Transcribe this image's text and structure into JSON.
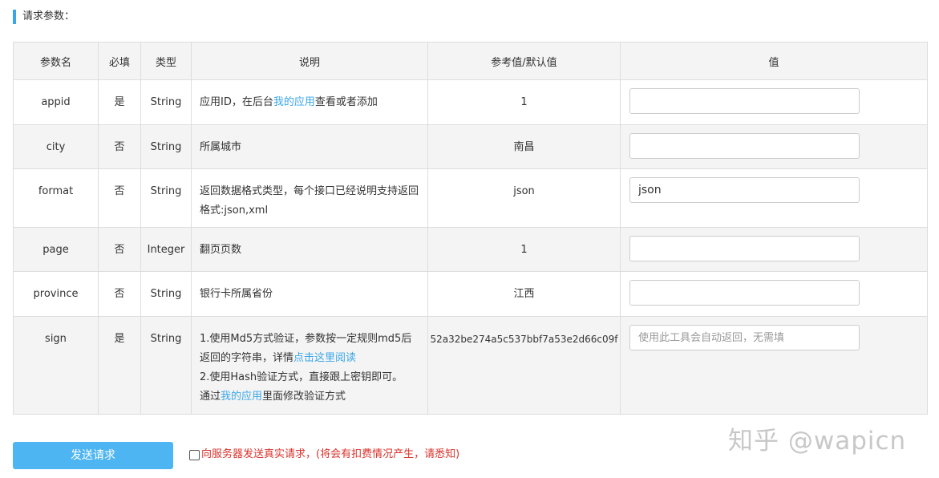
{
  "section_title": "请求参数：",
  "table": {
    "headers": [
      "参数名",
      "必填",
      "类型",
      "说明",
      "参考值/默认值",
      "值"
    ],
    "rows": [
      {
        "name": "appid",
        "required": "是",
        "type": "String",
        "desc_before": "应用ID，在后台",
        "desc_link": "我的应用",
        "desc_after": "查看或者添加",
        "ref": "1",
        "value": "",
        "placeholder": ""
      },
      {
        "name": "city",
        "required": "否",
        "type": "String",
        "desc": "所属城市",
        "ref": "南昌",
        "value": "",
        "placeholder": ""
      },
      {
        "name": "format",
        "required": "否",
        "type": "String",
        "desc": "返回数据格式类型，每个接口已经说明支持返回格式:json,xml",
        "ref": "json",
        "value": "json",
        "placeholder": ""
      },
      {
        "name": "page",
        "required": "否",
        "type": "Integer",
        "desc": "翻页页数",
        "ref": "1",
        "value": "",
        "placeholder": ""
      },
      {
        "name": "province",
        "required": "否",
        "type": "String",
        "desc": "银行卡所属省份",
        "ref": "江西",
        "value": "",
        "placeholder": ""
      },
      {
        "name": "sign",
        "required": "是",
        "type": "String",
        "desc_line1": "1.使用Md5方式验证，参数按一定规则md5后返回的字符串，详情",
        "desc_link1": "点击这里阅读",
        "desc_line2": "2.使用Hash验证方式，直接跟上密钥即可。",
        "desc_line3_before": "通过",
        "desc_link2": "我的应用",
        "desc_line3_after": "里面修改验证方式",
        "ref": "52a32be274a5c537bbf7a53e2d66c09f",
        "value": "",
        "placeholder": "使用此工具会自动返回，无需填"
      }
    ]
  },
  "send_button_label": "发送请求",
  "real_request_label": "向服务器发送真实请求，(将会有扣费情况产生，请悉知)",
  "watermark": "知乎 @wapicn",
  "colors": {
    "accent": "#3aa6e8",
    "button": "#4db5f2",
    "required": "#d9332c",
    "row_alt": "#f4f4f4"
  }
}
